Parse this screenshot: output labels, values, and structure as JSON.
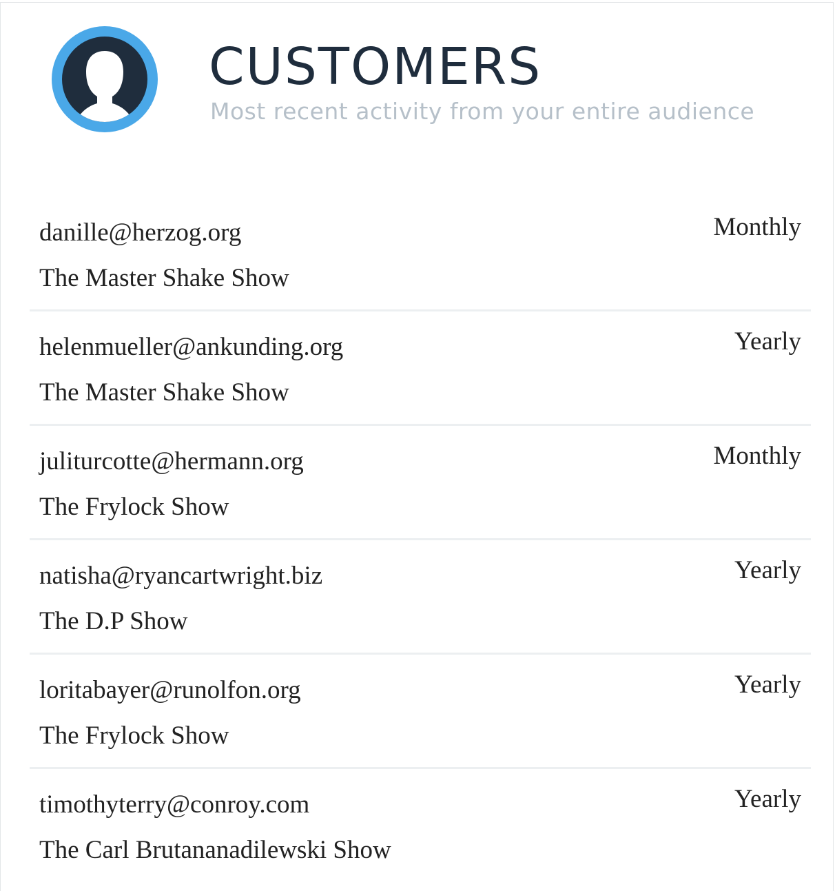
{
  "header": {
    "icon": "user-avatar-icon",
    "title": "CUSTOMERS",
    "subtitle": "Most recent activity from your entire audience"
  },
  "colors": {
    "avatar_ring": "#4aa8e8",
    "avatar_fill": "#1f2d3d",
    "title": "#1f2d3d",
    "subtitle": "#b6c0c9",
    "divider": "#eceff1",
    "text": "#222222"
  },
  "customers": [
    {
      "email": "danille@herzog.org",
      "show": "The Master Shake Show",
      "plan": "Monthly"
    },
    {
      "email": "helenmueller@ankunding.org",
      "show": "The Master Shake Show",
      "plan": "Yearly"
    },
    {
      "email": "juliturcotte@hermann.org",
      "show": "The Frylock Show",
      "plan": "Monthly"
    },
    {
      "email": "natisha@ryancartwright.biz",
      "show": "The D.P Show",
      "plan": "Yearly"
    },
    {
      "email": "loritabayer@runolfon.org",
      "show": "The Frylock Show",
      "plan": "Yearly"
    },
    {
      "email": "timothyterry@conroy.com",
      "show": "The Carl Brutananadilewski Show",
      "plan": "Yearly"
    }
  ]
}
